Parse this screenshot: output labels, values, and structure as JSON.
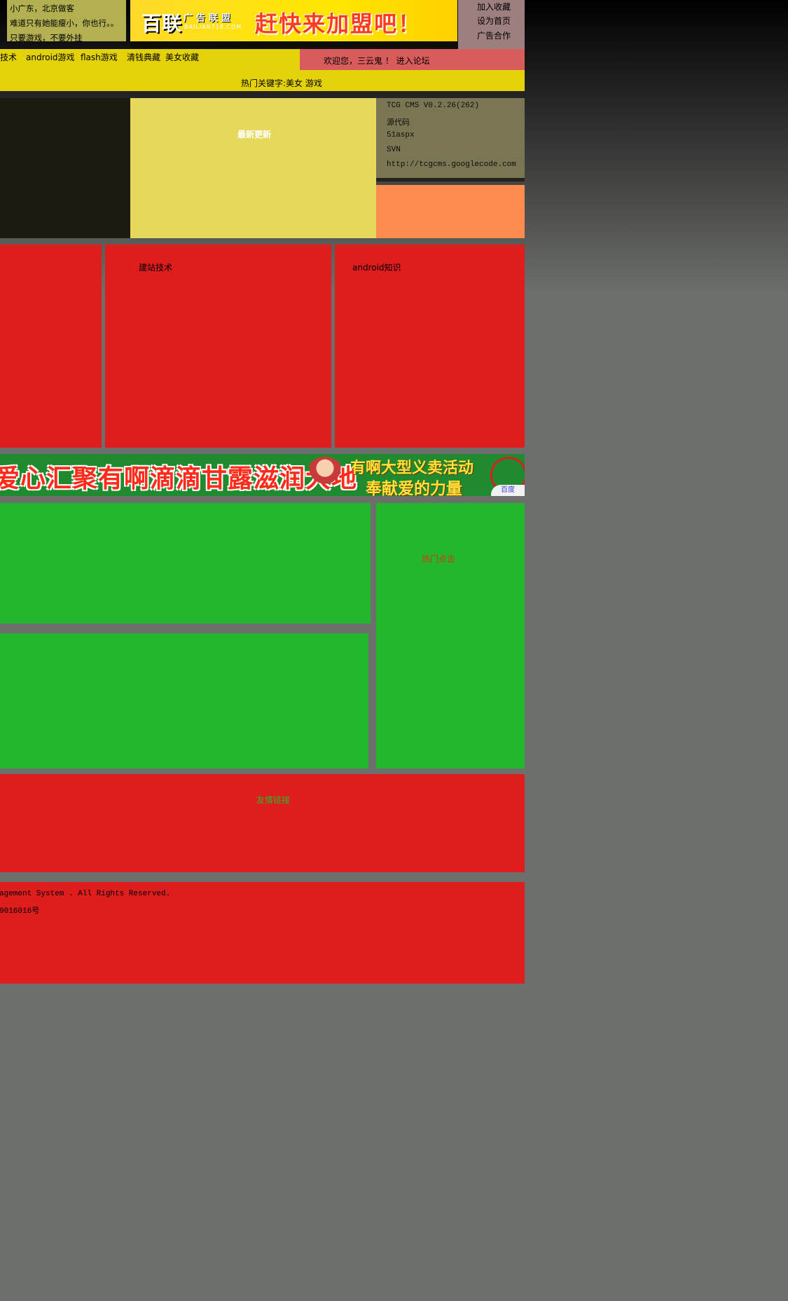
{
  "header": {
    "notes": [
      "小广东，北京做客",
      "难道只有她能瘦小，你也行。。",
      "只要游戏，不要外挂"
    ],
    "banner": {
      "logo": "百联",
      "subtitle": "广告联盟",
      "domain": "BAILIAN718.COM",
      "slogan": "赶快来加盟吧！"
    },
    "quick_links": [
      "加入收藏",
      "设为首页",
      "广告合作"
    ]
  },
  "nav": {
    "items": [
      "技术",
      "android游戏",
      "flash游戏",
      "清钱典藏",
      "美女收藏"
    ],
    "welcome": "欢迎您，三云鬼 ！ 进入论坛"
  },
  "hot_keywords": "热门关键字:美女 游戏",
  "latest": {
    "title": "最新更新"
  },
  "info": {
    "lines": [
      "TCG CMS V0.2.26(262)",
      "源代码",
      "51aspx",
      "SVN",
      "http://tcgcms.googlecode.com"
    ]
  },
  "sections": {
    "web_tech": "建站技术",
    "android": "android知识"
  },
  "banner_mid": {
    "left_text": "爱心汇聚有啊",
    "main_text": "滴滴甘露滋润大地",
    "right_line1": "有啊大型义卖活动",
    "right_line2": "奉献爱的力量",
    "corner": "百度"
  },
  "hot_click": {
    "title": "热门点击"
  },
  "friend_links": {
    "title": "友情链接"
  },
  "footer": {
    "copyright": "agement System . All Rights Reserved.",
    "icp": "9016016号"
  },
  "colors": {
    "red": "#e01d1d",
    "green": "#22b72d",
    "yellow": "#e3d20a",
    "orange": "#ff8c4f"
  }
}
